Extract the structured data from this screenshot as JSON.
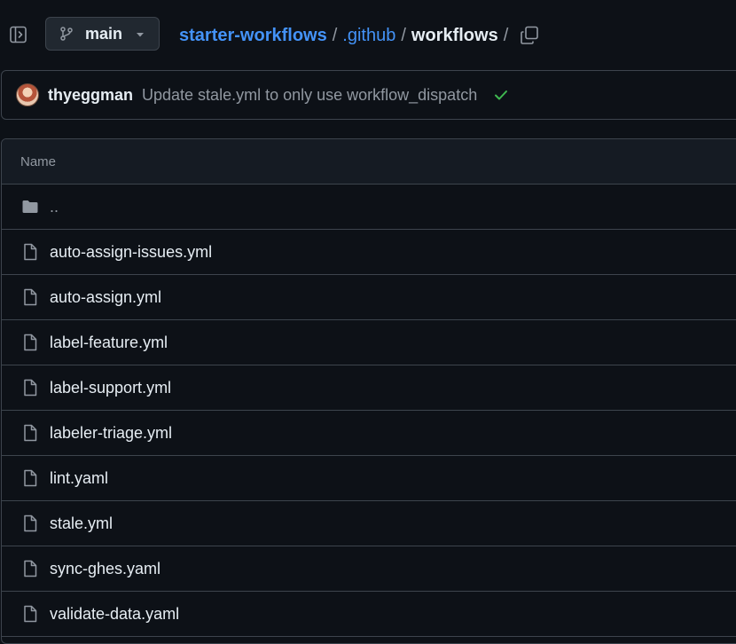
{
  "header": {
    "branch": "main",
    "breadcrumb": {
      "repo": "starter-workflows",
      "folder": ".github",
      "current": "workflows",
      "separator": "/"
    },
    "icons": [
      "sidebar-expand-icon",
      "git-branch-icon",
      "caret-down-icon",
      "copy-icon"
    ]
  },
  "commit": {
    "author": "thyeggman",
    "message": "Update stale.yml to only use workflow_dispatch",
    "status": "success",
    "status_color": "#3fb950"
  },
  "table": {
    "header": "Name",
    "parent_label": "..",
    "files": [
      "auto-assign-issues.yml",
      "auto-assign.yml",
      "label-feature.yml",
      "label-support.yml",
      "labeler-triage.yml",
      "lint.yaml",
      "stale.yml",
      "sync-ghes.yaml",
      "validate-data.yaml"
    ]
  },
  "colors": {
    "background": "#0d1117",
    "link": "#4493f8",
    "muted": "#9198a1",
    "border": "#3d444d"
  }
}
